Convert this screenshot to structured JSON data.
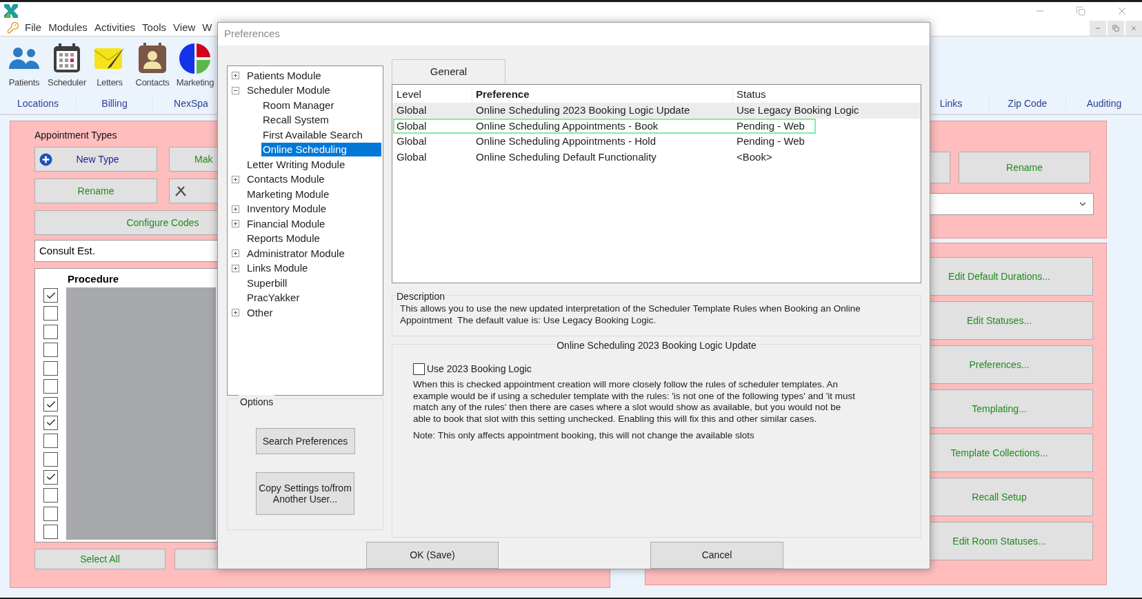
{
  "menu": [
    "File",
    "Modules",
    "Activities",
    "Tools",
    "View",
    "W"
  ],
  "toolbar": [
    {
      "label": "Patients"
    },
    {
      "label": "Scheduler"
    },
    {
      "label": "Letters"
    },
    {
      "label": "Contacts"
    },
    {
      "label": "Marketing"
    }
  ],
  "nav_links_left": [
    "Locations",
    "Billing",
    "NexSpa"
  ],
  "nav_links_right": [
    "Links",
    "Zip Code",
    "Auditing"
  ],
  "appointment_types": {
    "title": "Appointment Types",
    "new_type": "New Type",
    "make": "Mak",
    "rename": "Rename",
    "configure_codes": "Configure Codes",
    "type_field": "Consult Est.",
    "grid_column": "Procedure",
    "checks": [
      {
        "checked": true
      },
      {
        "checked": false
      },
      {
        "checked": false
      },
      {
        "checked": false
      },
      {
        "checked": false
      },
      {
        "checked": false
      },
      {
        "checked": true
      },
      {
        "checked": true
      },
      {
        "checked": false
      },
      {
        "checked": false
      },
      {
        "checked": true
      },
      {
        "checked": false
      },
      {
        "checked": false
      },
      {
        "checked": false
      }
    ],
    "select_all": "Select All"
  },
  "right_panel": {
    "rename": "Rename",
    "buttons": [
      "Edit Default Durations...",
      "Edit Statuses...",
      "Preferences...",
      "Templating...",
      "Template Collections...",
      "Recall Setup",
      "Edit Room Statuses..."
    ]
  },
  "dialog": {
    "title": "Preferences",
    "tree": [
      {
        "label": "Patients Module",
        "expanded": false
      },
      {
        "label": "Scheduler Module",
        "expanded": true,
        "children": [
          {
            "label": "Room Manager",
            "selected": false
          },
          {
            "label": "Recall System",
            "selected": false
          },
          {
            "label": "First Available Search",
            "selected": false
          },
          {
            "label": "Online Scheduling",
            "selected": true
          }
        ]
      },
      {
        "label": "Letter Writing Module"
      },
      {
        "label": "Contacts Module",
        "expanded": false
      },
      {
        "label": "Marketing Module"
      },
      {
        "label": "Inventory Module",
        "expanded": false
      },
      {
        "label": "Financial Module",
        "expanded": false
      },
      {
        "label": "Reports Module"
      },
      {
        "label": "Administrator Module",
        "expanded": false
      },
      {
        "label": "Links Module",
        "expanded": false
      },
      {
        "label": "Superbill"
      },
      {
        "label": "PracYakker"
      },
      {
        "label": "Other",
        "expanded": false
      }
    ],
    "options": {
      "title": "Options",
      "buttons": [
        "Search Preferences",
        "Copy Settings to/from Another User..."
      ]
    },
    "tabs": [
      {
        "label": "General",
        "selected": true
      }
    ],
    "table": {
      "columns": [
        "Level",
        "Preference",
        "Status"
      ],
      "rows": [
        {
          "cells": [
            "Global",
            "Online Scheduling 2023 Booking Logic Update",
            "Use Legacy Booking Logic"
          ],
          "selected": true,
          "focused": false
        },
        {
          "cells": [
            "Global",
            "Online Scheduling Appointments - Book",
            "Pending - Web"
          ],
          "selected": false,
          "focused": true
        },
        {
          "cells": [
            "Global",
            "Online Scheduling Appointments - Hold",
            "Pending - Web"
          ],
          "selected": false,
          "focused": false
        },
        {
          "cells": [
            "Global",
            "Online Scheduling Default Functionality",
            "<Book>"
          ],
          "selected": false,
          "focused": false
        }
      ]
    },
    "description": {
      "title": "Description",
      "text": "This allows you to use the new updated interpretation of the Scheduler Template Rules when Booking an Online Appointment  The default value is: Use Legacy Booking Logic."
    },
    "setting": {
      "title": "Online Scheduling 2023 Booking Logic Update",
      "checkbox": {
        "label": "Use 2023 Booking Logic",
        "checked": false
      },
      "text": "When this is checked appointment creation will more closely follow the rules of scheduler templates. An example would be if using a scheduler template with the rules: 'is not one of the following types' and 'it must match any of the rules' then there are cases where a slot would show as available, but you would not be able to book that slot with this setting unchecked. Enabling this will fix this and other similar cases.",
      "note": "Note: This only affects appointment booking, this will not change the available slots"
    },
    "ok": "OK (Save)",
    "cancel": "Cancel"
  }
}
